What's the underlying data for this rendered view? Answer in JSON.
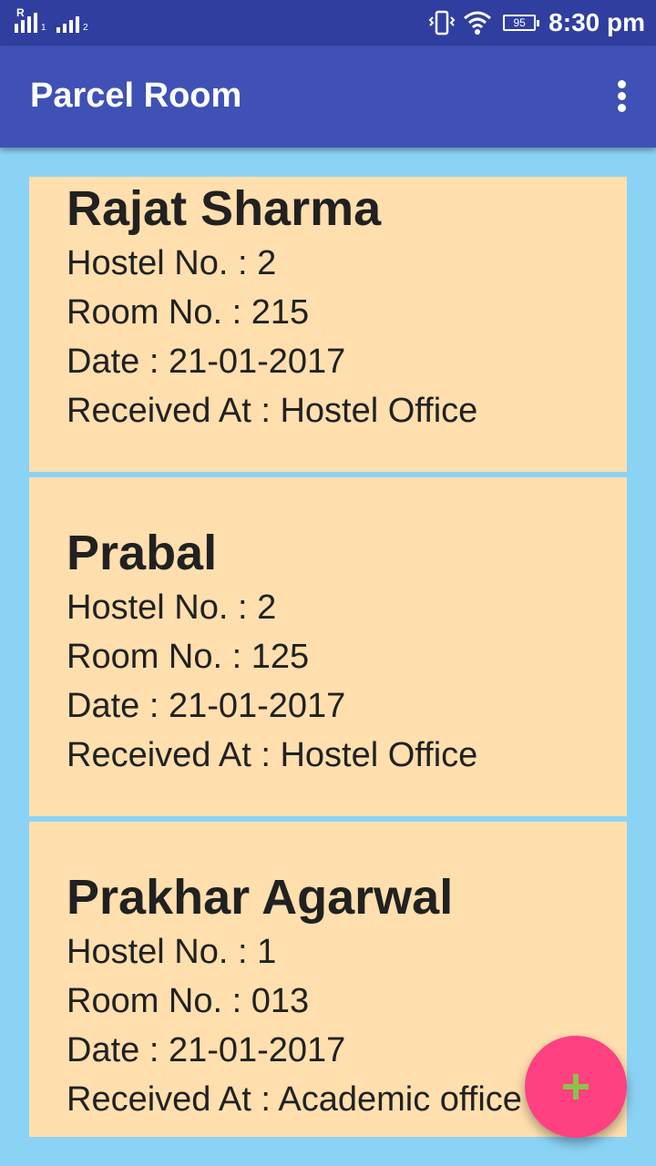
{
  "status_bar": {
    "sim1_label": "R",
    "sim1_sub": "1",
    "sim2_sub": "2",
    "battery_level": "95",
    "time": "8:30 pm",
    "icons": [
      "signal-icon",
      "vibrate-icon",
      "wifi-icon",
      "battery-icon"
    ]
  },
  "app_bar": {
    "title": "Parcel Room",
    "menu_icon": "more-vert-icon"
  },
  "parcels": [
    {
      "name": "Rajat Sharma",
      "hostel": "Hostel No. : 2",
      "room": "Room No. : 215",
      "date": "Date : 21-01-2017",
      "received": "Received At : Hostel Office"
    },
    {
      "name": "Prabal",
      "hostel": "Hostel No. : 2",
      "room": "Room No. : 125",
      "date": "Date : 21-01-2017",
      "received": "Received At : Hostel Office"
    },
    {
      "name": "Prakhar Agarwal",
      "hostel": "Hostel No. : 1",
      "room": "Room No. : 013",
      "date": "Date : 21-01-2017",
      "received": "Received At : Academic office"
    }
  ],
  "fab": {
    "icon": "plus-icon"
  },
  "colors": {
    "status_bar": "#303f9f",
    "app_bar": "#3f51b5",
    "background": "#8bd3f5",
    "card": "#ffdfae",
    "fab": "#ff4081",
    "fab_icon": "#8bc34a"
  }
}
